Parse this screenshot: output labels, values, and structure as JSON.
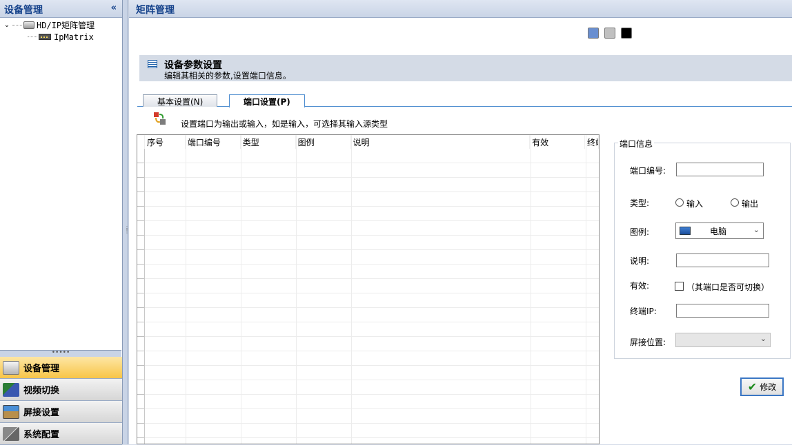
{
  "left_panel": {
    "title": "设备管理",
    "collapse": "«",
    "tree": [
      {
        "label": "HD/IP矩阵管理",
        "expanded": true,
        "icon": "server-icon"
      },
      {
        "label": "IpMatrix",
        "icon": "matrix-device-icon"
      }
    ],
    "splitter_grip": "•••••",
    "nav": [
      {
        "label": "设备管理",
        "icon": "device-icon",
        "active": true
      },
      {
        "label": "视频切换",
        "icon": "video-switch-icon",
        "active": false
      },
      {
        "label": "屏接设置",
        "icon": "screen-icon",
        "active": false
      },
      {
        "label": "系统配置",
        "icon": "tools-icon",
        "active": false
      }
    ]
  },
  "right_panel": {
    "title": "矩阵管理",
    "theme_swatches": [
      "#6a8fd0",
      "#c0c0c0",
      "#000000"
    ],
    "param": {
      "title": "设备参数设置",
      "desc": "编辑其相关的参数,设置端口信息。"
    },
    "tabs": [
      {
        "label": "基本设置(N)",
        "selected": false
      },
      {
        "label": "端口设置(P)",
        "selected": true
      }
    ],
    "hint": "设置端口为输出或输入，如是输入，可选择其输入源类型",
    "grid": {
      "columns": [
        "序号",
        "端口编号",
        "类型",
        "图例",
        "说明",
        "有效",
        "终端"
      ]
    },
    "port_info": {
      "legend": "端口信息",
      "port_no_label": "端口编号:",
      "port_no_value": "",
      "type_label": "类型:",
      "type_input": "输入",
      "type_output": "输出",
      "icon_label": "图例:",
      "icon_value": "电脑",
      "desc_label": "说明:",
      "desc_value": "",
      "valid_label": "有效:",
      "valid_hint": "（其端口是否可切换）",
      "ip_label": "终端IP:",
      "ip_value": "",
      "screen_label": "屏接位置:",
      "screen_value": ""
    },
    "modify_button": "修改"
  }
}
